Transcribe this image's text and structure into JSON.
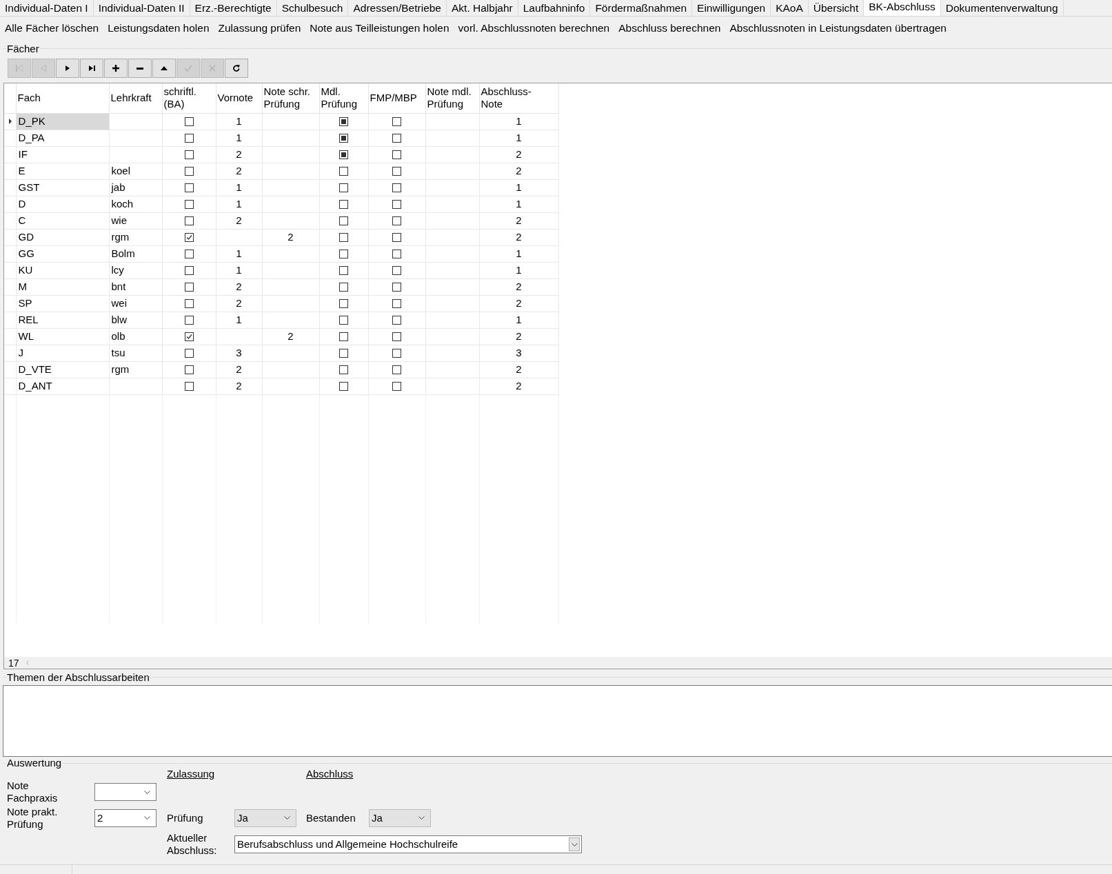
{
  "tabs": [
    {
      "label": "Individual-Daten I",
      "selected": false
    },
    {
      "label": "Individual-Daten II",
      "selected": false
    },
    {
      "label": "Erz.-Berechtigte",
      "selected": false
    },
    {
      "label": "Schulbesuch",
      "selected": false
    },
    {
      "label": "Adressen/Betriebe",
      "selected": false
    },
    {
      "label": "Akt. Halbjahr",
      "selected": false
    },
    {
      "label": "Laufbahninfo",
      "selected": false
    },
    {
      "label": "Fördermaßnahmen",
      "selected": false
    },
    {
      "label": "Einwilligungen",
      "selected": false
    },
    {
      "label": "KAoA",
      "selected": false
    },
    {
      "label": "Übersicht",
      "selected": false
    },
    {
      "label": "BK-Abschluss",
      "selected": true
    },
    {
      "label": "Dokumentenverwaltung",
      "selected": false
    }
  ],
  "actions": [
    "Alle Fächer löschen",
    "Leistungsdaten holen",
    "Zulassung prüfen",
    "Note aus Teilleistungen holen",
    "vorl. Abschlussnoten berechnen",
    "Abschluss berechnen",
    "Abschlussnoten in Leistungsdaten übertragen"
  ],
  "faecher": {
    "title": "Fächer",
    "toolbar": [
      {
        "kind": "first",
        "disabled": true
      },
      {
        "kind": "prior",
        "disabled": true
      },
      {
        "kind": "next",
        "disabled": false
      },
      {
        "kind": "last",
        "disabled": false
      },
      {
        "kind": "insert",
        "disabled": false
      },
      {
        "kind": "delete",
        "disabled": false
      },
      {
        "kind": "edit",
        "disabled": false
      },
      {
        "kind": "post",
        "disabled": true
      },
      {
        "kind": "cancel",
        "disabled": true
      },
      {
        "kind": "refresh",
        "disabled": false
      }
    ],
    "table": {
      "columns": [
        {
          "label": "Fach",
          "kind": "text"
        },
        {
          "label": "Lehrkraft",
          "kind": "text"
        },
        {
          "label": "schriftl.\n(BA)",
          "kind": "check"
        },
        {
          "label": "Vornote",
          "kind": "num"
        },
        {
          "label": "Note schr.\nPrüfung",
          "kind": "num"
        },
        {
          "label": "Mdl.\nPrüfung",
          "kind": "flag"
        },
        {
          "label": "FMP/MBP",
          "kind": "check"
        },
        {
          "label": "Note mdl.\nPrüfung",
          "kind": "num"
        },
        {
          "label": "Abschluss-\nNote",
          "kind": "num"
        }
      ],
      "rows": [
        {
          "selected": true,
          "fach": "D_PK",
          "schriftl_ba": false,
          "vornote": "1",
          "mdl_pruefung": true,
          "fmp_mbp": false,
          "abschluss_note": "1"
        },
        {
          "selected": false,
          "fach": "D_PA",
          "schriftl_ba": false,
          "vornote": "1",
          "mdl_pruefung": true,
          "fmp_mbp": false,
          "abschluss_note": "1"
        },
        {
          "selected": false,
          "fach": "IF",
          "schriftl_ba": false,
          "vornote": "2",
          "mdl_pruefung": true,
          "fmp_mbp": false,
          "abschluss_note": "2"
        },
        {
          "selected": false,
          "fach": "E",
          "lehrkraft": "koel",
          "schriftl_ba": false,
          "vornote": "2",
          "mdl_pruefung": false,
          "fmp_mbp": false,
          "abschluss_note": "2"
        },
        {
          "selected": false,
          "fach": "GST",
          "lehrkraft": "jab",
          "schriftl_ba": false,
          "vornote": "1",
          "mdl_pruefung": false,
          "fmp_mbp": false,
          "abschluss_note": "1"
        },
        {
          "selected": false,
          "fach": "D",
          "lehrkraft": "koch",
          "schriftl_ba": false,
          "vornote": "1",
          "mdl_pruefung": false,
          "fmp_mbp": false,
          "abschluss_note": "1"
        },
        {
          "selected": false,
          "fach": "C",
          "lehrkraft": "wie",
          "schriftl_ba": false,
          "vornote": "2",
          "mdl_pruefung": false,
          "fmp_mbp": false,
          "abschluss_note": "2"
        },
        {
          "selected": false,
          "fach": "GD",
          "lehrkraft": "rgm",
          "schriftl_ba": true,
          "note_schr_pruefung": "2",
          "mdl_pruefung": false,
          "fmp_mbp": false,
          "abschluss_note": "2"
        },
        {
          "selected": false,
          "fach": "GG",
          "lehrkraft": "Bolm",
          "schriftl_ba": false,
          "vornote": "1",
          "mdl_pruefung": false,
          "fmp_mbp": false,
          "abschluss_note": "1"
        },
        {
          "selected": false,
          "fach": "KU",
          "lehrkraft": "lcy",
          "schriftl_ba": false,
          "vornote": "1",
          "mdl_pruefung": false,
          "fmp_mbp": false,
          "abschluss_note": "1"
        },
        {
          "selected": false,
          "fach": "M",
          "lehrkraft": "bnt",
          "schriftl_ba": false,
          "vornote": "2",
          "mdl_pruefung": false,
          "fmp_mbp": false,
          "abschluss_note": "2"
        },
        {
          "selected": false,
          "fach": "SP",
          "lehrkraft": "wei",
          "schriftl_ba": false,
          "vornote": "2",
          "mdl_pruefung": false,
          "fmp_mbp": false,
          "abschluss_note": "2"
        },
        {
          "selected": false,
          "fach": "REL",
          "lehrkraft": "blw",
          "schriftl_ba": false,
          "vornote": "1",
          "mdl_pruefung": false,
          "fmp_mbp": false,
          "abschluss_note": "1"
        },
        {
          "selected": false,
          "fach": "WL",
          "lehrkraft": "olb",
          "schriftl_ba": true,
          "note_schr_pruefung": "2",
          "mdl_pruefung": false,
          "fmp_mbp": false,
          "abschluss_note": "2"
        },
        {
          "selected": false,
          "fach": "J",
          "lehrkraft": "tsu",
          "schriftl_ba": false,
          "vornote": "3",
          "mdl_pruefung": false,
          "fmp_mbp": false,
          "abschluss_note": "3"
        },
        {
          "selected": false,
          "fach": "D_VTE",
          "lehrkraft": "rgm",
          "schriftl_ba": false,
          "vornote": "2",
          "mdl_pruefung": false,
          "fmp_mbp": false,
          "abschluss_note": "2"
        },
        {
          "selected": false,
          "fach": "D_ANT",
          "schriftl_ba": false,
          "vornote": "2",
          "mdl_pruefung": false,
          "fmp_mbp": false,
          "abschluss_note": "2"
        }
      ]
    },
    "record_count": "17"
  },
  "themen": {
    "title": "Themen der Abschlussarbeiten"
  },
  "auswertung": {
    "title": "Auswertung",
    "zulassung_heading": "Zulassung",
    "abschluss_heading": "Abschluss",
    "note_fachpraxis": {
      "label": "Note\nFachpraxis",
      "disabled": false
    },
    "note_prakt_pruefung": {
      "label": "Note prakt.\nPrüfung",
      "value": "2",
      "disabled": false
    },
    "pruefung": {
      "label": "Prüfung",
      "value": "Ja",
      "disabled": true
    },
    "bestanden": {
      "label": "Bestanden",
      "value": "Ja",
      "disabled": true
    },
    "aktueller_abschluss": {
      "label": "Aktueller\nAbschluss:",
      "value": "Berufsabschluss und Allgemeine Hochschulreife",
      "disabled": false
    }
  }
}
